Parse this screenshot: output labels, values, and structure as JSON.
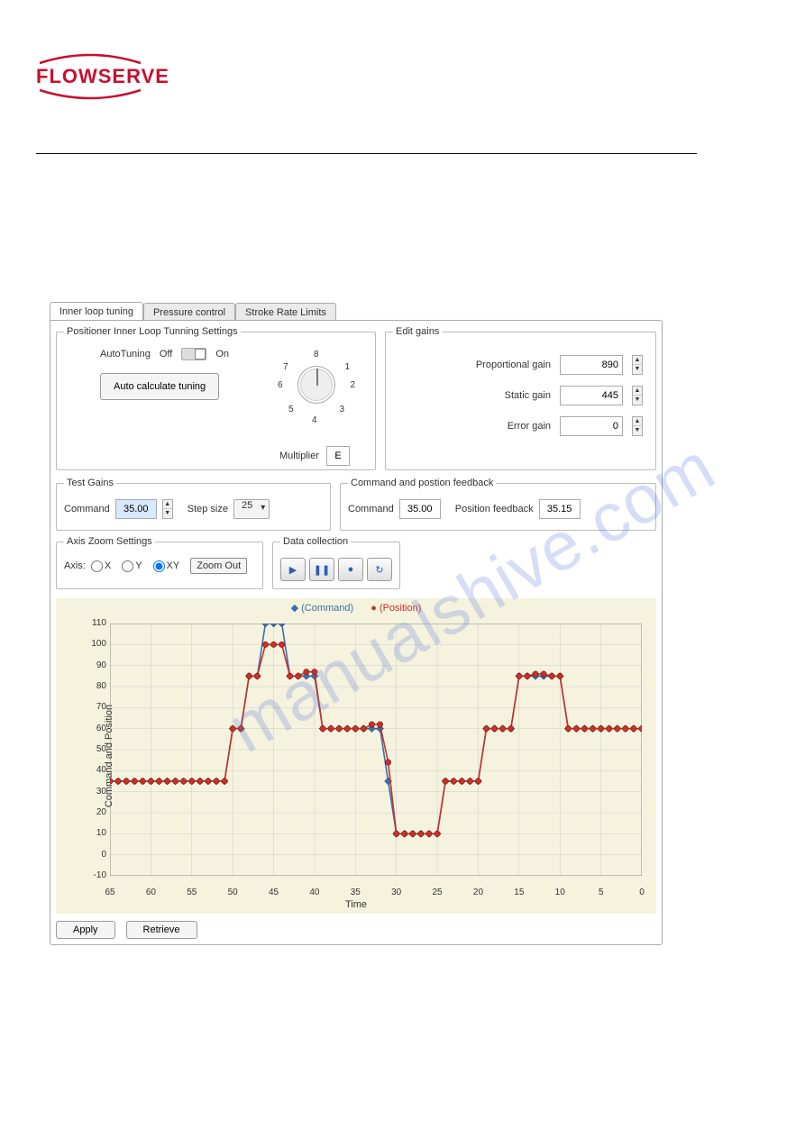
{
  "brand": "FLOWSERVE",
  "tabs": {
    "inner": "Inner loop tuning",
    "pressure": "Pressure control",
    "stroke": "Stroke Rate Limits"
  },
  "inner_settings": {
    "legend": "Positioner Inner Loop Tunning Settings",
    "autotuning_label": "AutoTuning",
    "off": "Off",
    "on": "On",
    "autocalc": "Auto calculate tuning",
    "multiplier_label": "Multiplier",
    "multiplier_value": "E",
    "dial": {
      "1": "1",
      "2": "2",
      "3": "3",
      "4": "4",
      "5": "5",
      "6": "6",
      "7": "7",
      "8": "8"
    }
  },
  "edit_gains": {
    "legend": "Edit gains",
    "proportional_label": "Proportional gain",
    "proportional_value": "890",
    "static_label": "Static gain",
    "static_value": "445",
    "error_label": "Error gain",
    "error_value": "0"
  },
  "test_gains": {
    "legend": "Test Gains",
    "command_label": "Command",
    "command_value": "35.00",
    "step_label": "Step size",
    "step_value": "25"
  },
  "cmd_feedback": {
    "legend": "Command and postion feedback",
    "command_label": "Command",
    "command_value": "35.00",
    "position_label": "Position feedback",
    "position_value": "35.15"
  },
  "axis_zoom": {
    "legend": "Axis Zoom Settings",
    "axis_label": "Axis:",
    "x": "X",
    "y": "Y",
    "xy": "XY",
    "zoom_out": "Zoom Out"
  },
  "data_collection": {
    "legend": "Data collection",
    "icons": {
      "play": "▶",
      "pause": "❚❚",
      "stop": "●",
      "refresh": "↻"
    }
  },
  "chart": {
    "legend_command": "(Command)",
    "legend_position": "(Position)",
    "ylabel": "Command and Position",
    "xlabel": "Time"
  },
  "buttons": {
    "apply": "Apply",
    "retrieve": "Retrieve"
  },
  "watermark": "manualshive.com",
  "chart_data": {
    "type": "line",
    "xlabel": "Time",
    "ylabel": "Command and Position",
    "xlim": [
      65,
      0
    ],
    "ylim": [
      -10,
      110
    ],
    "x_ticks": [
      65,
      60,
      55,
      50,
      45,
      40,
      35,
      30,
      25,
      20,
      15,
      10,
      5,
      0
    ],
    "y_ticks": [
      -10,
      0,
      10,
      20,
      30,
      40,
      50,
      60,
      70,
      80,
      90,
      100,
      110
    ],
    "series": [
      {
        "name": "(Command)",
        "color": "#3a6fb0",
        "marker": "diamond",
        "x": [
          65,
          64,
          63,
          62,
          61,
          60,
          59,
          58,
          57,
          56,
          55,
          54,
          53,
          52,
          51,
          50,
          49,
          48,
          47,
          46,
          45,
          44,
          43,
          42,
          41,
          40,
          39,
          38,
          37,
          36,
          35,
          34,
          33,
          32,
          31,
          30,
          29,
          28,
          27,
          26,
          25,
          24,
          23,
          22,
          21,
          20,
          19,
          18,
          17,
          16,
          15,
          14,
          13,
          12,
          11,
          10,
          9,
          8,
          7,
          6,
          5,
          4,
          3,
          2,
          1,
          0
        ],
        "values": [
          35,
          35,
          35,
          35,
          35,
          35,
          35,
          35,
          35,
          35,
          35,
          35,
          35,
          35,
          35,
          60,
          60,
          85,
          85,
          110,
          110,
          110,
          85,
          85,
          85,
          85,
          60,
          60,
          60,
          60,
          60,
          60,
          60,
          60,
          35,
          10,
          10,
          10,
          10,
          10,
          10,
          35,
          35,
          35,
          35,
          35,
          60,
          60,
          60,
          60,
          85,
          85,
          85,
          85,
          85,
          85,
          60,
          60,
          60,
          60,
          60,
          60,
          60,
          60,
          60,
          60
        ]
      },
      {
        "name": "(Position)",
        "color": "#c8302a",
        "marker": "circle",
        "x": [
          65,
          64,
          63,
          62,
          61,
          60,
          59,
          58,
          57,
          56,
          55,
          54,
          53,
          52,
          51,
          50,
          49,
          48,
          47,
          46,
          45,
          44,
          43,
          42,
          41,
          40,
          39,
          38,
          37,
          36,
          35,
          34,
          33,
          32,
          31,
          30,
          29,
          28,
          27,
          26,
          25,
          24,
          23,
          22,
          21,
          20,
          19,
          18,
          17,
          16,
          15,
          14,
          13,
          12,
          11,
          10,
          9,
          8,
          7,
          6,
          5,
          4,
          3,
          2,
          1,
          0
        ],
        "values": [
          35,
          35,
          35,
          35,
          35,
          35,
          35,
          35,
          35,
          35,
          35,
          35,
          35,
          35,
          35,
          60,
          60,
          85,
          85,
          100,
          100,
          100,
          85,
          85,
          87,
          87,
          60,
          60,
          60,
          60,
          60,
          60,
          62,
          62,
          44,
          10,
          10,
          10,
          10,
          10,
          10,
          35,
          35,
          35,
          35,
          35,
          60,
          60,
          60,
          60,
          85,
          85,
          86,
          86,
          85,
          85,
          60,
          60,
          60,
          60,
          60,
          60,
          60,
          60,
          60,
          60
        ]
      }
    ]
  }
}
